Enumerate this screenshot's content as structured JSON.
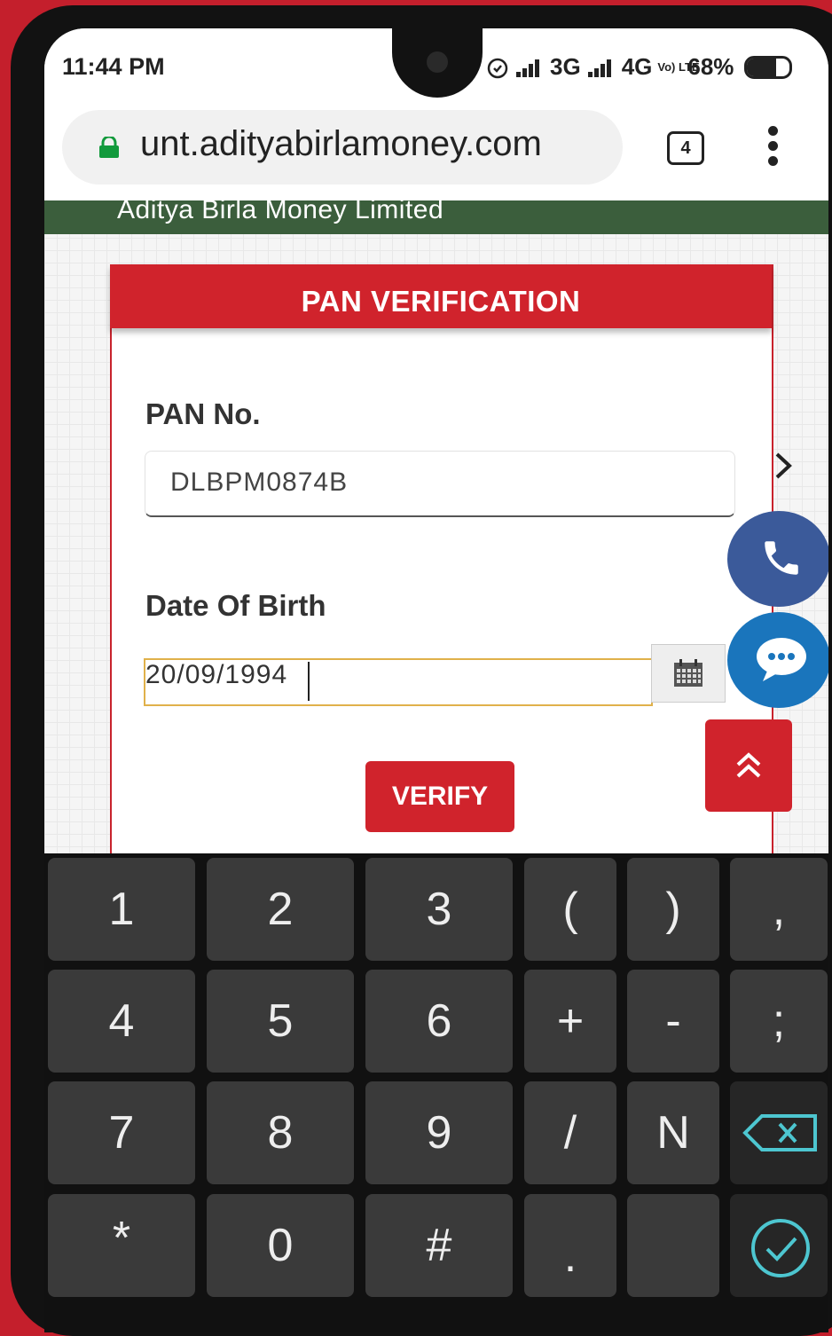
{
  "status_bar": {
    "time": "11:44 PM",
    "network_1": "3G",
    "network_2": "4G",
    "volte": "Vo) LTE",
    "battery_percent": "68%",
    "battery_level": 0.68
  },
  "browser": {
    "url": "unt.adityabirlamoney.com",
    "tab_count": "4"
  },
  "page": {
    "company_banner": "Aditya Birla Money Limited",
    "card_title": "PAN VERIFICATION",
    "pan_label": "PAN No.",
    "pan_value": "DLBPM0874B",
    "dob_label": "Date Of Birth",
    "dob_value": "20/09/1994",
    "verify_label": "VERIFY"
  },
  "keyboard": {
    "rows": [
      [
        "1",
        "2",
        "3",
        "(",
        ")",
        ","
      ],
      [
        "4",
        "5",
        "6",
        "+",
        "-",
        ";"
      ],
      [
        "7",
        "8",
        "9",
        "/",
        "N",
        "backspace"
      ],
      [
        "*",
        "0",
        "#",
        ".",
        "",
        "done"
      ]
    ]
  },
  "colors": {
    "brand_red": "#d0232c",
    "banner_green": "#3b5e3c",
    "call_blue": "#3b5a9a",
    "chat_blue": "#1a75bc"
  }
}
